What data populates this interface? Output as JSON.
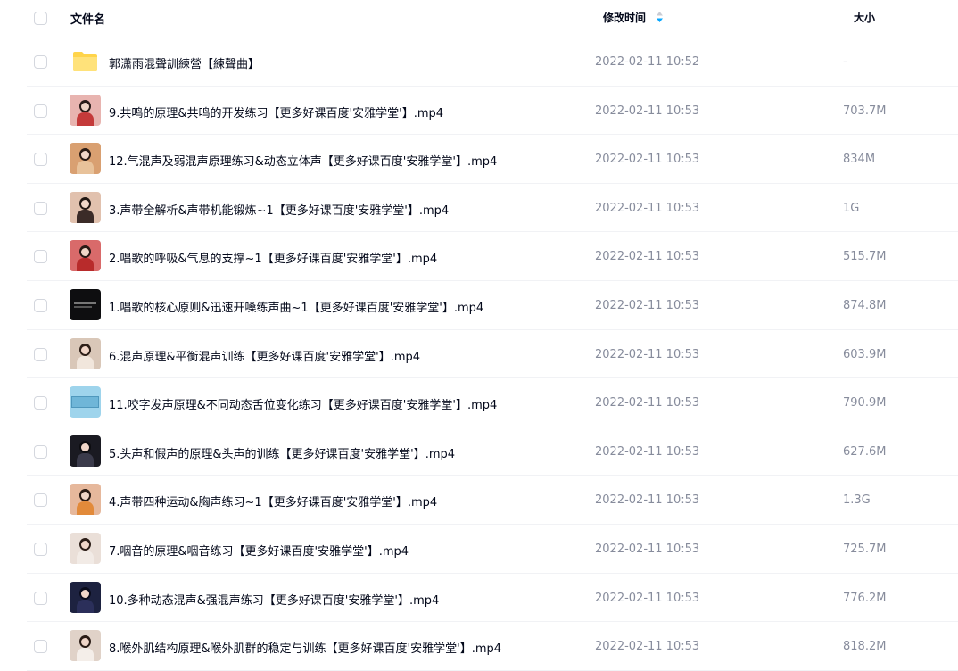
{
  "header": {
    "name_label": "文件名",
    "time_label": "修改时间",
    "size_label": "大小",
    "sort_icon": "sort-icon"
  },
  "colors": {
    "sort_accent": "#06a7ff",
    "folder": "#ffd44a"
  },
  "files": [
    {
      "name": "郭潇雨混聲訓練營【練聲曲】",
      "time": "2022-02-11 10:52",
      "size": "-",
      "icon": "folder-icon",
      "kind": "folder"
    },
    {
      "name": "9.共鸣的原理&共鸣的开发练习【更多好课百度'安雅学堂'】.mp4",
      "time": "2022-02-11 10:53",
      "size": "703.7M",
      "icon": "video-thumbnail",
      "kind": "video"
    },
    {
      "name": "12.气混声及弱混声原理练习&动态立体声【更多好课百度'安雅学堂'】.mp4",
      "time": "2022-02-11 10:53",
      "size": "834M",
      "icon": "video-thumbnail",
      "kind": "video"
    },
    {
      "name": "3.声带全解析&声带机能锻炼~1【更多好课百度'安雅学堂'】.mp4",
      "time": "2022-02-11 10:53",
      "size": "1G",
      "icon": "video-thumbnail",
      "kind": "video"
    },
    {
      "name": "2.唱歌的呼吸&气息的支撑~1【更多好课百度'安雅学堂'】.mp4",
      "time": "2022-02-11 10:53",
      "size": "515.7M",
      "icon": "video-thumbnail",
      "kind": "video"
    },
    {
      "name": "1.唱歌的核心原则&迅速开嗓练声曲~1【更多好课百度'安雅学堂'】.mp4",
      "time": "2022-02-11 10:53",
      "size": "874.8M",
      "icon": "video-thumbnail",
      "kind": "video"
    },
    {
      "name": "6.混声原理&平衡混声训练【更多好课百度'安雅学堂'】.mp4",
      "time": "2022-02-11 10:53",
      "size": "603.9M",
      "icon": "video-thumbnail",
      "kind": "video"
    },
    {
      "name": "11.咬字发声原理&不同动态舌位变化练习【更多好课百度'安雅学堂'】.mp4",
      "time": "2022-02-11 10:53",
      "size": "790.9M",
      "icon": "video-thumbnail",
      "kind": "video"
    },
    {
      "name": "5.头声和假声的原理&头声的训练【更多好课百度'安雅学堂'】.mp4",
      "time": "2022-02-11 10:53",
      "size": "627.6M",
      "icon": "video-thumbnail",
      "kind": "video"
    },
    {
      "name": "4.声带四种运动&胸声练习~1【更多好课百度'安雅学堂'】.mp4",
      "time": "2022-02-11 10:53",
      "size": "1.3G",
      "icon": "video-thumbnail",
      "kind": "video"
    },
    {
      "name": "7.咽音的原理&咽音练习【更多好课百度'安雅学堂'】.mp4",
      "time": "2022-02-11 10:53",
      "size": "725.7M",
      "icon": "video-thumbnail",
      "kind": "video"
    },
    {
      "name": "10.多种动态混声&强混声练习【更多好课百度'安雅学堂'】.mp4",
      "time": "2022-02-11 10:53",
      "size": "776.2M",
      "icon": "video-thumbnail",
      "kind": "video"
    },
    {
      "name": "8.喉外肌结构原理&喉外肌群的稳定与训练【更多好课百度'安雅学堂'】.mp4",
      "time": "2022-02-11 10:53",
      "size": "818.2M",
      "icon": "video-thumbnail",
      "kind": "video"
    }
  ]
}
